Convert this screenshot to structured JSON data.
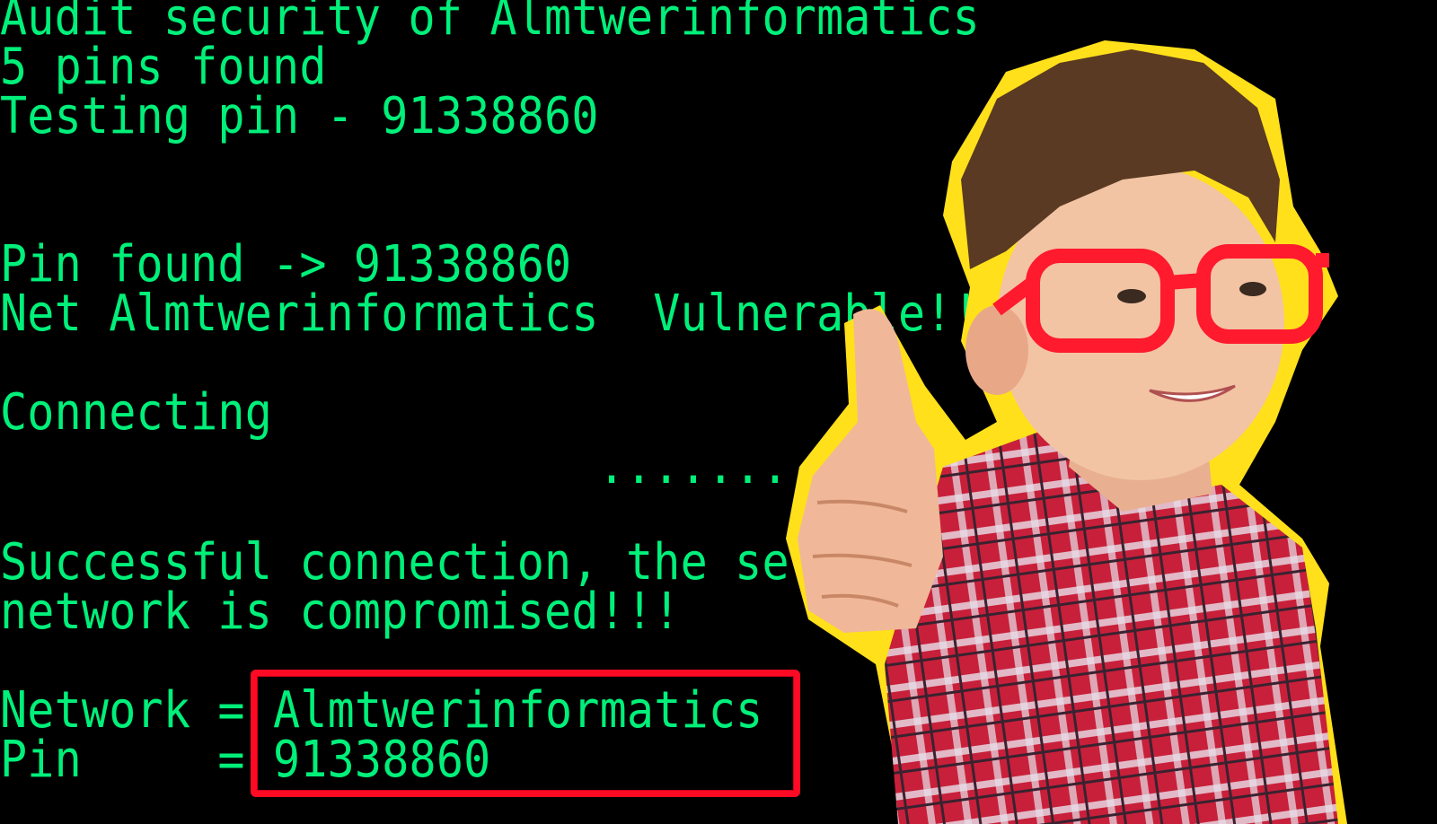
{
  "terminal": {
    "lines": {
      "audit": "Audit security of Almtwerinformatics",
      "pins_found": "5 pins found",
      "testing": "Testing pin - 91338860",
      "pin_found": "Pin found -> 91338860",
      "vulnerable": "Net Almtwerinformatics  Vulnerable!!",
      "connecting": "Connecting",
      "dots": ".......",
      "success_1": "Successful connection, the se",
      "success_2": "network is compromised!!!",
      "network_label": "Network =",
      "network_value": "Almtwerinformatics",
      "pin_label": "Pin     =",
      "pin_value": "91338860"
    },
    "colors": {
      "text": "#00f07a",
      "background": "#000000",
      "highlight_box": "#ff0a24",
      "outline": "#ffe01a"
    }
  }
}
